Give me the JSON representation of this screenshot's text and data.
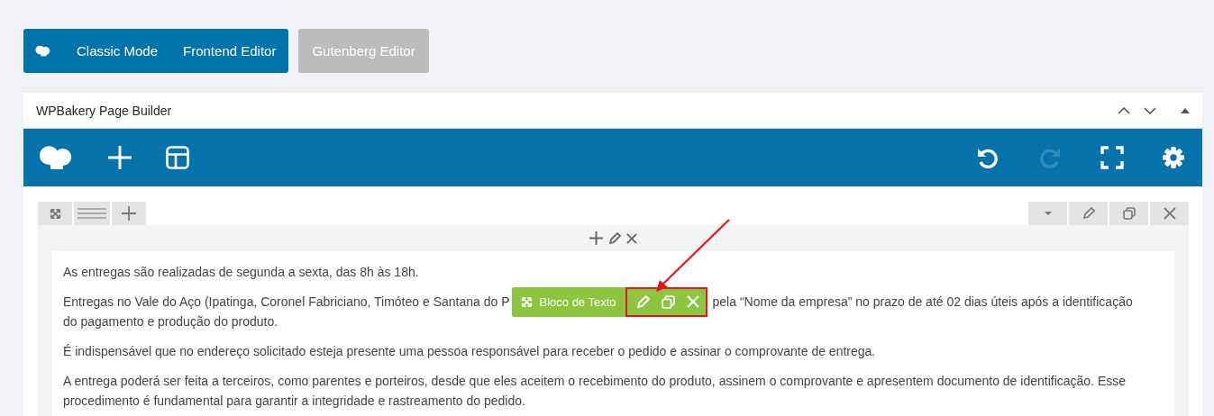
{
  "mode_bar": {
    "buttons": [
      {
        "label": "Classic Mode"
      },
      {
        "label": "Frontend Editor"
      }
    ],
    "gutenberg": {
      "label": "Gutenberg Editor",
      "disabled": true
    }
  },
  "panel": {
    "title": "WPBakery Page Builder",
    "toolbar": {
      "redo_disabled": true
    },
    "element_overlay": {
      "label": "Bloco de Texto"
    },
    "paragraphs": [
      {
        "lines": [
          "As entregas são realizadas de segunda a sexta, das 8h às 18h."
        ]
      },
      {
        "before": "Entregas no Vale do Aço (Ipatinga, Coronel Fabriciano, Timóteo e Santana do P",
        "after": "pela “Nome da empresa” no prazo de até 02 dias úteis após a identificação",
        "lines": [
          "do pagamento e produção do produto."
        ]
      },
      {
        "lines": [
          "É indispensável que no endereço solicitado esteja presente uma pessoa responsável para receber o pedido e assinar o comprovante de entrega."
        ]
      },
      {
        "lines": [
          "A entrega poderá ser feita a terceiros, como parentes e porteiros, desde que eles aceitem o recebimento do produto, assinem o comprovante e apresentem documento de identificação. Esse",
          "procedimento é fundamental para garantir a integridade e rastreamento do pedido."
        ]
      }
    ]
  }
}
